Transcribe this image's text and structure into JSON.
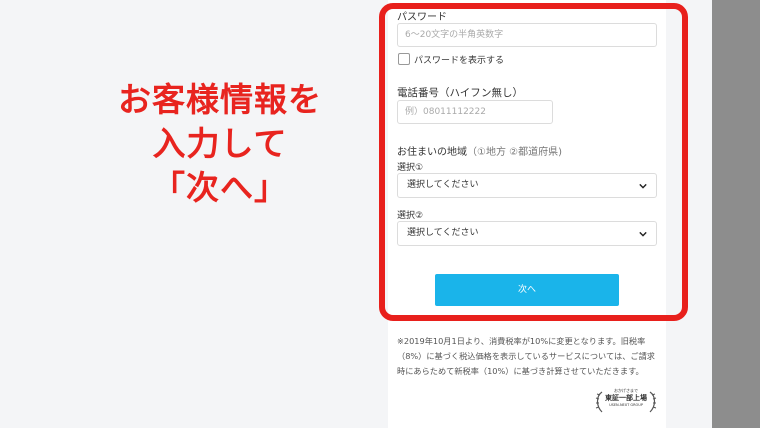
{
  "caption": {
    "line1": "お客様情報を",
    "line2": "入力して",
    "line3": "「次へ」"
  },
  "password": {
    "label": "パスワード",
    "placeholder": "6〜20文字の半角英数字",
    "show_label": "パスワードを表示する"
  },
  "phone": {
    "label": "電話番号（ハイフン無し）",
    "placeholder": "例）08011112222"
  },
  "region": {
    "label": "お住まいの地域",
    "hint": "（①地方 ②都道府県)",
    "select1_label": "選択①",
    "select1_value": "選択してください",
    "select2_label": "選択②",
    "select2_value": "選択してください"
  },
  "next_button": "次へ",
  "note": "※2019年10月1日より、消費税率が10%に変更となります。旧税率（8%）に基づく税込価格を表示しているサービスについては、ご請求時にあらためて新税率（10%）に基づき計算させていただきます。",
  "badge": {
    "small": "おかげさまで",
    "main": "東証一部上場",
    "sub": "USEN-NEXT GROUP"
  },
  "colors": {
    "accent_red": "#e8201c",
    "button_blue": "#1ab4ea"
  }
}
